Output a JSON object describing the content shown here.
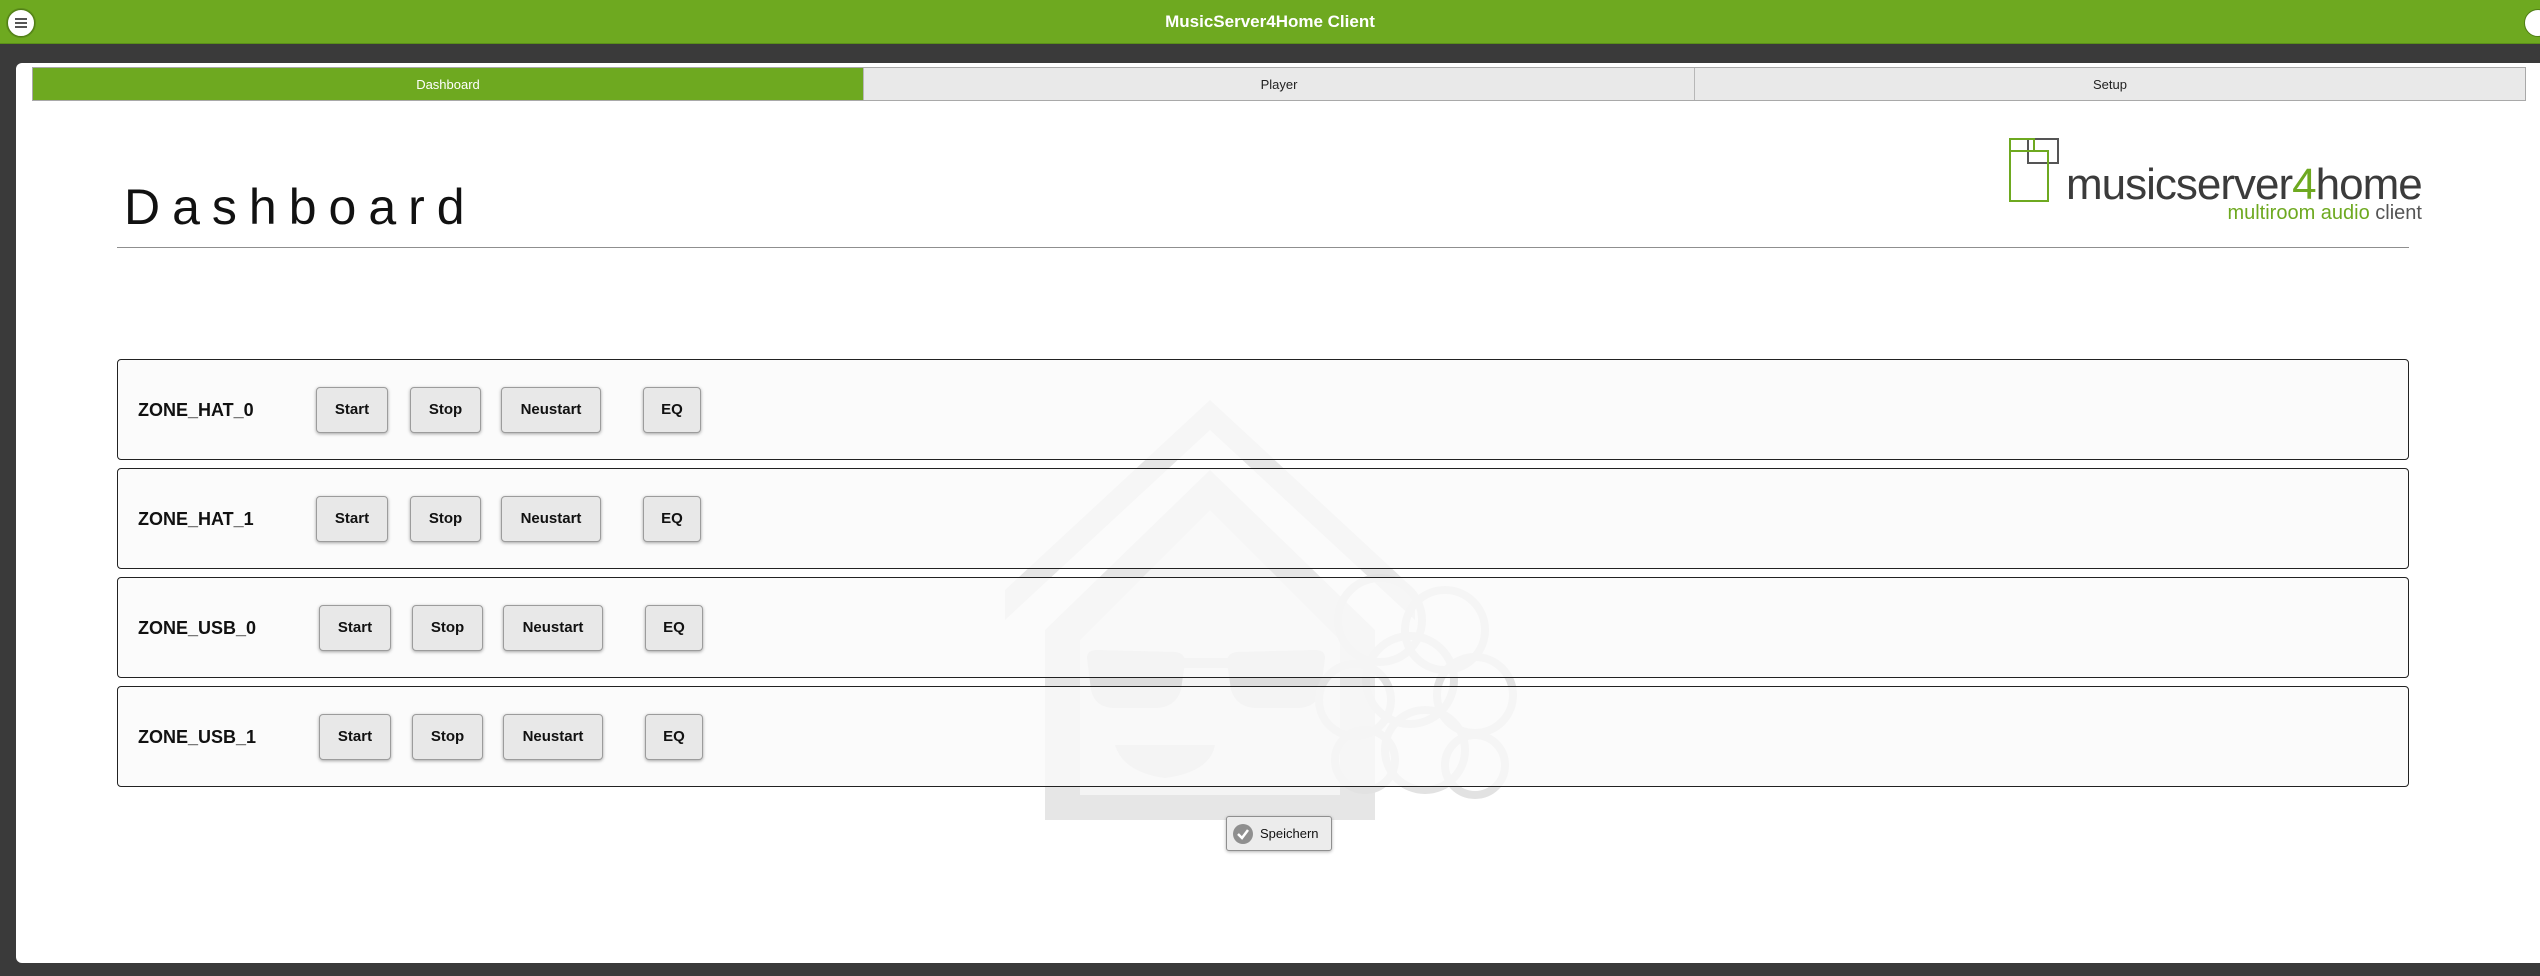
{
  "app": {
    "title": "MusicServer4Home Client"
  },
  "tabs": [
    {
      "label": "Dashboard",
      "active": true
    },
    {
      "label": "Player",
      "active": false
    },
    {
      "label": "Setup",
      "active": false
    }
  ],
  "page": {
    "title": "Dashboard"
  },
  "logo": {
    "text_main": "musicserver",
    "text_four": "4",
    "text_home": "home",
    "sub_green": "multiroom audio",
    "sub_dark": "client"
  },
  "zones": [
    {
      "name": "ZONE_HAT_0",
      "start": "Start",
      "stop": "Stop",
      "restart": "Neustart",
      "eq": "EQ"
    },
    {
      "name": "ZONE_HAT_1",
      "start": "Start",
      "stop": "Stop",
      "restart": "Neustart",
      "eq": "EQ"
    },
    {
      "name": "ZONE_USB_0",
      "start": "Start",
      "stop": "Stop",
      "restart": "Neustart",
      "eq": "EQ"
    },
    {
      "name": "ZONE_USB_1",
      "start": "Start",
      "stop": "Stop",
      "restart": "Neustart",
      "eq": "EQ"
    }
  ],
  "save_button": {
    "label": "Speichern"
  },
  "colors": {
    "accent": "#6ea920",
    "frame": "#3a3a3a"
  },
  "icons": {
    "menu": "menu-icon",
    "save": "check-icon"
  }
}
